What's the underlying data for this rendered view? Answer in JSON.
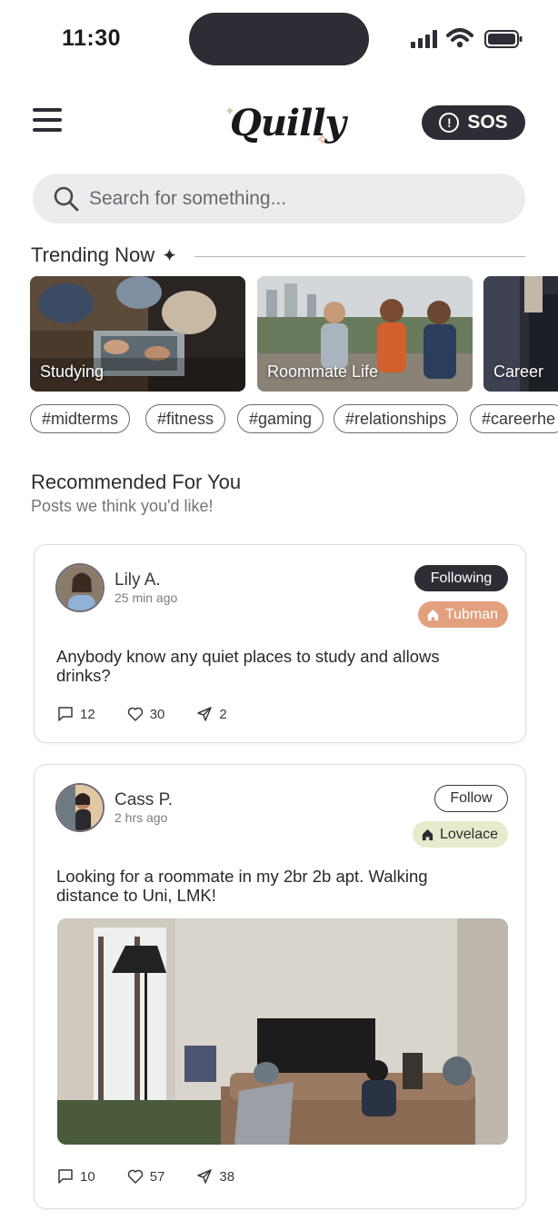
{
  "status_bar": {
    "time": "11:30"
  },
  "header": {
    "logo": "Quilly",
    "sos_label": "SOS"
  },
  "search": {
    "placeholder": "Search for something..."
  },
  "trending": {
    "title": "Trending Now",
    "cards": [
      {
        "label": "Studying"
      },
      {
        "label": "Roommate Life"
      },
      {
        "label": "Career"
      }
    ],
    "tags": [
      "#midterms",
      "#fitness",
      "#gaming",
      "#relationships",
      "#careerhe"
    ]
  },
  "recommended": {
    "title": "Recommended For You",
    "subtitle": "Posts we think you'd like!"
  },
  "posts": [
    {
      "name": "Lily A.",
      "time": "25 min ago",
      "follow_label": "Following",
      "house": "Tubman",
      "house_color": "#e3a07e",
      "text": "Anybody know any quiet places to study and allows drinks?",
      "comments": "12",
      "likes": "30",
      "shares": "2"
    },
    {
      "name": "Cass P.",
      "time": "2 hrs ago",
      "follow_label": "Follow",
      "house": "Lovelace",
      "house_color": "#e4eccb",
      "text": "Looking for a roommate in my 2br 2b apt. Walking distance to Uni, LMK!",
      "comments": "10",
      "likes": "57",
      "shares": "38"
    }
  ]
}
